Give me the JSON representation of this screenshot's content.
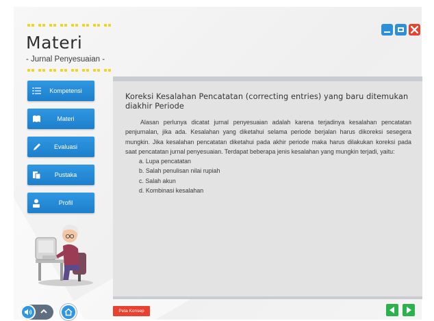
{
  "header": {
    "title": "Materi",
    "subtitle": "- Jurnal Penyesuaian -"
  },
  "window_controls": [
    "minimize-icon",
    "maximize-icon",
    "close-icon"
  ],
  "menu": {
    "items": [
      {
        "label": "Kompetensi",
        "icon": "list-icon"
      },
      {
        "label": "Materi",
        "icon": "book-icon"
      },
      {
        "label": "Evaluasi",
        "icon": "pencil-icon"
      },
      {
        "label": "Pustaka",
        "icon": "library-icon"
      },
      {
        "label": "Profil",
        "icon": "user-icon"
      }
    ]
  },
  "content": {
    "title": "Koreksi Kesalahan Pencatatan (correcting entries) yang baru ditemukan diakhir Periode",
    "paragraph": "Alasan perlunya dicatat jurnal penyesuaian adalah karena terjadinya kesalahan pencatatan penjurnalan, jika ada. Kesalahan yang diketahui selama periode berjalan harus dikoreksi sesegera mungkin. Jika kesalahan pencatatan diketahui pada akhir periode maka harus dilakukan koreksi pada saat pencatatan jurnal penyesuaian. Terdapat beberapa jenis kesalahan yang mungkin terjadi, yaitu:",
    "list": [
      "a. Lupa pencatatan",
      "b. Salah penulisan nilai rupiah",
      "c. Salah akun",
      "d. Kombinasi kesalahan"
    ]
  },
  "footer": {
    "peta_label": "Peta Konsep"
  },
  "colors": {
    "accent_blue": "#2f97e2",
    "close_red": "#e8412f",
    "nav_green": "#2bb24c",
    "dot_yellow": "#f2d31b"
  }
}
